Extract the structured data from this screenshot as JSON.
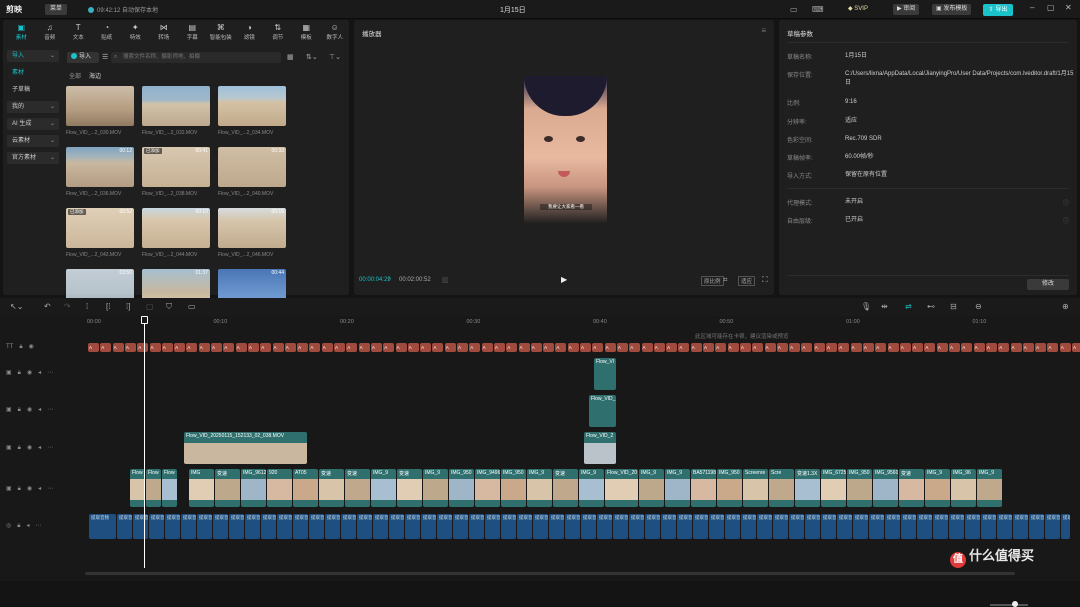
{
  "topbar": {
    "logo": "剪映",
    "menu": "菜单",
    "autosave": "09:42:12 自动保存本地",
    "title": "1月15日",
    "svip": "SVIP",
    "review": "审阅",
    "publish": "发布模板",
    "export": "导出"
  },
  "media": {
    "tabs": [
      {
        "label": "素材",
        "icon": "▣"
      },
      {
        "label": "音频",
        "icon": "♫"
      },
      {
        "label": "文本",
        "icon": "T"
      },
      {
        "label": "贴纸",
        "icon": "◔"
      },
      {
        "label": "特效",
        "icon": "✦"
      },
      {
        "label": "转场",
        "icon": "⋈"
      },
      {
        "label": "字幕",
        "icon": "▤"
      },
      {
        "label": "智能包装",
        "icon": "⌘"
      },
      {
        "label": "滤镜",
        "icon": "◑"
      },
      {
        "label": "调节",
        "icon": "⇅"
      },
      {
        "label": "模板",
        "icon": "▦"
      },
      {
        "label": "数字人",
        "icon": "☺"
      }
    ],
    "side": {
      "import": "导入",
      "material": "素材",
      "subtitle_mirror": "子草稿",
      "mine": "我的",
      "ai": "AI 生成",
      "cloud": "云素材",
      "official": "官方素材"
    },
    "import_btn": "导入",
    "search_placeholder": "搜索文件名称、摄影师地、拍摄",
    "filters": {
      "all": "全部",
      "beach": "海边"
    },
    "thumbs": [
      {
        "name": "Flow_VID_...2_030.MOV",
        "dur": "",
        "added": ""
      },
      {
        "name": "Flow_VID_...2_032.MOV",
        "dur": "",
        "added": ""
      },
      {
        "name": "Flow_VID_...2_034.MOV",
        "dur": "",
        "added": ""
      },
      {
        "name": "Flow_VID_...2_036.MOV",
        "dur": "00:12",
        "added": ""
      },
      {
        "name": "Flow_VID_...2_038.MOV",
        "dur": "00:41",
        "added": "已添加"
      },
      {
        "name": "Flow_VID_...2_040.MOV",
        "dur": "00:33",
        "added": ""
      },
      {
        "name": "Flow_VID_...2_042.MOV",
        "dur": "00:52",
        "added": "已添加"
      },
      {
        "name": "Flow_VID_...2_044.MOV",
        "dur": "00:10",
        "added": ""
      },
      {
        "name": "Flow_VID_...2_046.MOV",
        "dur": "00:16",
        "added": ""
      },
      {
        "name": "",
        "dur": "03:50",
        "added": ""
      },
      {
        "name": "",
        "dur": "01:37",
        "added": ""
      },
      {
        "name": "",
        "dur": "00:44",
        "added": ""
      }
    ]
  },
  "player": {
    "title": "播放器",
    "subtitle": "我要让大家看一看",
    "time_current": "00:00:04:29",
    "time_total": "00:02:00:52",
    "ratio": "适应",
    "quality": "原比例"
  },
  "params": {
    "title": "草稿参数",
    "rows": [
      {
        "k": "草稿名称:",
        "v": "1月15日"
      },
      {
        "k": "保存位置:",
        "v": "C:/Users/lixna/AppData/Local/JianyingPro/User Data/Projects/com.lveditor.draft/1月15日"
      },
      {
        "k": "比例:",
        "v": "9:16"
      },
      {
        "k": "分辨率:",
        "v": "适应"
      },
      {
        "k": "色彩空间:",
        "v": "Rec.709 SDR"
      },
      {
        "k": "草稿帧率:",
        "v": "60.00帧/秒"
      },
      {
        "k": "导入方式:",
        "v": "保留在原有位置"
      },
      {
        "k": "代理模式:",
        "v": "未开启"
      },
      {
        "k": "自由层级:",
        "v": "已开启"
      }
    ],
    "modify": "修改"
  },
  "timeline": {
    "ruler": [
      "00:00",
      "00:10",
      "00:20",
      "00:30",
      "00:40",
      "00:50",
      "01:00",
      "01:10"
    ],
    "hint": "此区域可能存在卡顿，建议渲染或预览",
    "top_clip_label": "Flow_VID_20250115_152133_02_038.MOV",
    "short_clip_1": "Flow_VI",
    "short_clip_2": "Flow_VID_",
    "short_clip_3": "Flow_VID_2",
    "main_labels": [
      "Flow",
      "Flow",
      "Flow",
      "IMG",
      "变速",
      "IMG_9612",
      "920",
      "AT05",
      "变速",
      "变速",
      "IMG_9",
      "变速",
      "IMG_9",
      "IMG_950",
      "IMG_9496",
      "IMG_950",
      "IMG_9",
      "变速",
      "IMG_9",
      "Flow_VID_20",
      "IMG_9",
      "IMG_9",
      "BA571198",
      "IMG_950",
      "Screenre",
      "Scre",
      "变速1.3X",
      "IMG_6725",
      "IMG_950",
      "IMG_9560",
      "变速",
      "IMG_9",
      "IMG_96",
      "IMG_9"
    ],
    "text_clip": "A",
    "audio_clip": "提取音频"
  },
  "watermark": "什么值得买"
}
